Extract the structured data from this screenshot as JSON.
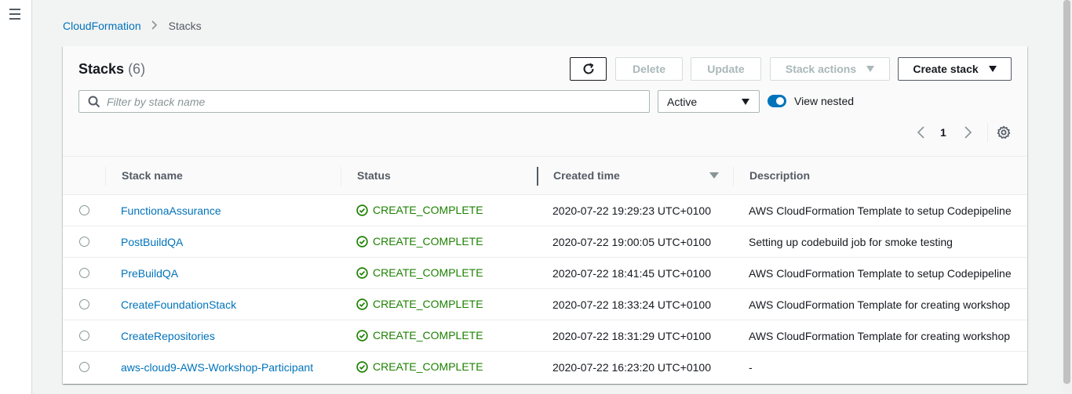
{
  "breadcrumb": {
    "root": "CloudFormation",
    "current": "Stacks"
  },
  "panel": {
    "title": "Stacks",
    "count": "(6)",
    "buttons": {
      "delete": "Delete",
      "update": "Update",
      "stack_actions": "Stack actions",
      "create_stack": "Create stack"
    },
    "search": {
      "placeholder": "Filter by stack name",
      "value": ""
    },
    "filter_select": {
      "selected": "Active"
    },
    "view_nested": {
      "label": "View nested",
      "on": true
    },
    "pagination": {
      "current_page": "1"
    }
  },
  "table": {
    "columns": {
      "name": "Stack name",
      "status": "Status",
      "created": "Created time",
      "description": "Description"
    },
    "rows": [
      {
        "name": "FunctionaAssurance",
        "status": "CREATE_COMPLETE",
        "created": "2020-07-22 19:29:23 UTC+0100",
        "description": "AWS CloudFormation Template to setup Codepipeline"
      },
      {
        "name": "PostBuildQA",
        "status": "CREATE_COMPLETE",
        "created": "2020-07-22 19:00:05 UTC+0100",
        "description": "Setting up codebuild job for smoke testing"
      },
      {
        "name": "PreBuildQA",
        "status": "CREATE_COMPLETE",
        "created": "2020-07-22 18:41:45 UTC+0100",
        "description": "AWS CloudFormation Template to setup Codepipeline"
      },
      {
        "name": "CreateFoundationStack",
        "status": "CREATE_COMPLETE",
        "created": "2020-07-22 18:33:24 UTC+0100",
        "description": "AWS CloudFormation Template for creating workshop"
      },
      {
        "name": "CreateRepositories",
        "status": "CREATE_COMPLETE",
        "created": "2020-07-22 18:31:29 UTC+0100",
        "description": "AWS CloudFormation Template for creating workshop"
      },
      {
        "name": "aws-cloud9-AWS-Workshop-Participant",
        "status": "CREATE_COMPLETE",
        "created": "2020-07-22 16:23:20 UTC+0100",
        "description": "-"
      }
    ]
  },
  "colors": {
    "link": "#0073bb",
    "success": "#1d8102",
    "toggle": "#0073bb"
  }
}
